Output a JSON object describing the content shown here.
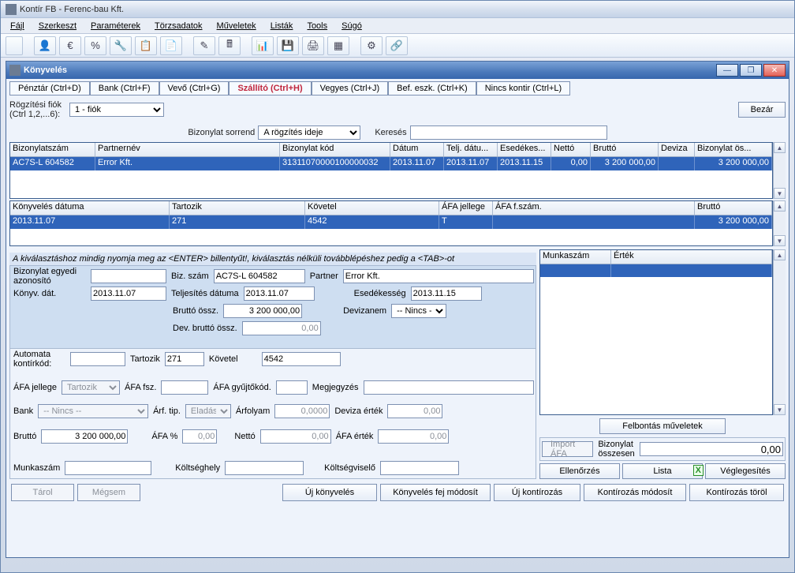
{
  "app": {
    "title": "Kontír FB  - Ferenc-bau Kft."
  },
  "menus": {
    "file": "Fájl",
    "edit": "Szerkeszt",
    "params": "Paraméterek",
    "master": "Törzsadatok",
    "ops": "Műveletek",
    "lists": "Listák",
    "tools": "Tools",
    "help": "Súgó"
  },
  "inner": {
    "title": "Könyvelés"
  },
  "tabs": {
    "penztar": "Pénztár (Ctrl+D)",
    "bank": "Bank (Ctrl+F)",
    "vevo": "Vevő (Ctrl+G)",
    "szallito": "Szállító (Ctrl+H)",
    "vegyes": "Vegyes (Ctrl+J)",
    "bef": "Bef. eszk. (Ctrl+K)",
    "nincs": "Nincs kontir (Ctrl+L)"
  },
  "rogz": {
    "label": "Rögzítési fiók (Ctrl 1,2,...6):",
    "value": "1 - fiók",
    "close": "Bezár"
  },
  "sort": {
    "label": "Bizonylat sorrend",
    "value": "A rögzítés ideje",
    "search": "Keresés"
  },
  "grid1": {
    "headers": {
      "biz": "Bizonylatszám",
      "partner": "Partnernév",
      "kod": "Bizonylat kód",
      "datum": "Dátum",
      "telj": "Telj. dátu...",
      "esed": "Esedékes...",
      "netto": "Nettó",
      "brutto": "Bruttó",
      "dev": "Deviza",
      "ossz": "Bizonylat ös..."
    },
    "row": {
      "biz": "AC7S-L 604582",
      "partner": "Error Kft.",
      "kod": "31311070000100000032",
      "datum": "2013.11.07",
      "telj": "2013.11.07",
      "esed": "2013.11.15",
      "netto": "0,00",
      "brutto": "3 200 000,00",
      "dev": "",
      "ossz": "3 200 000,00"
    }
  },
  "grid2": {
    "headers": {
      "kdat": "Könyvelés dátuma",
      "tart": "Tartozik",
      "kov": "Követel",
      "afaj": "ÁFA jellege",
      "afasz": "ÁFA f.szám.",
      "brutto": "Bruttó"
    },
    "row": {
      "kdat": "2013.11.07",
      "tart": "271",
      "kov": "4542",
      "afaj": "T",
      "afasz": "",
      "brutto": "3 200 000,00"
    }
  },
  "info": "A kiválasztáshoz mindig nyomja meg az <ENTER> billentyűt!, kiválasztás nélküli továbblépéshez pedig a <TAB>-ot",
  "form": {
    "bizegyedi_l": "Bizonylat egyedi azonosító",
    "bizegyedi_v": "",
    "bizszam_l": "Biz. szám",
    "bizszam_v": "AC7S-L 604582",
    "partner_l": "Partner",
    "partner_v": "Error Kft.",
    "konyvdat_l": "Könyv. dát.",
    "konyvdat_v": "2013.11.07",
    "teljdat_l": "Teljesítés dátuma",
    "teljdat_v": "2013.11.07",
    "esed_l": "Esedékesség",
    "esed_v": "2013.11.15",
    "brutto_l": "Bruttó össz.",
    "brutto_v": "3 200 000,00",
    "devnem_l": "Devizanem",
    "devnem_v": "-- Nincs -",
    "devbr_l": "Dev. bruttó össz.",
    "devbr_v": "0,00",
    "autok_l": "Automata kontírkód:",
    "autok_v": "",
    "tart_l": "Tartozik",
    "tart_v": "271",
    "kov_l": "Követel",
    "kov_v": "4542",
    "afaj_l": "ÁFA jellege",
    "afaj_v": "Tartozik",
    "afafsz_l": "ÁFA fsz.",
    "afafsz_v": "",
    "afagy_l": "ÁFA gyűjtőkód.",
    "afagy_v": "",
    "megj_l": "Megjegyzés",
    "megj_v": "",
    "bank_l": "Bank",
    "bank_v": "-- Nincs --",
    "arftip_l": "Árf. tip.",
    "arftip_v": "Eladási",
    "arf_l": "Árfolyam",
    "arf_v": "0,0000",
    "dever_l": "Deviza érték",
    "dever_v": "0,00",
    "br2_l": "Bruttó",
    "br2_v": "3 200 000,00",
    "afapct_l": "ÁFA %",
    "afapct_v": "0,00",
    "netto_l": "Nettó",
    "netto_v": "0,00",
    "afaer_l": "ÁFA érték",
    "afaer_v": "0,00",
    "munk_l": "Munkaszám",
    "khely_l": "Költséghely",
    "kvis_l": "Költségviselő"
  },
  "right": {
    "mszam": "Munkaszám",
    "ertek": "Érték",
    "felbont": "Felbontás műveletek",
    "impafa": "Import ÁFA",
    "bizossz_l": "Bizonylat összesen",
    "bizossz_v": "0,00",
    "ellen": "Ellenőrzés",
    "lista": "Lista",
    "vegleg": "Véglegesítés"
  },
  "bottom": {
    "tarol": "Tárol",
    "megse": "Mégsem",
    "ujk": "Új könyvelés",
    "fejmod": "Könyvelés fej módosít",
    "ujkont": "Új kontírozás",
    "kontmod": "Kontírozás módosít",
    "konttor": "Kontírozás töröl"
  }
}
